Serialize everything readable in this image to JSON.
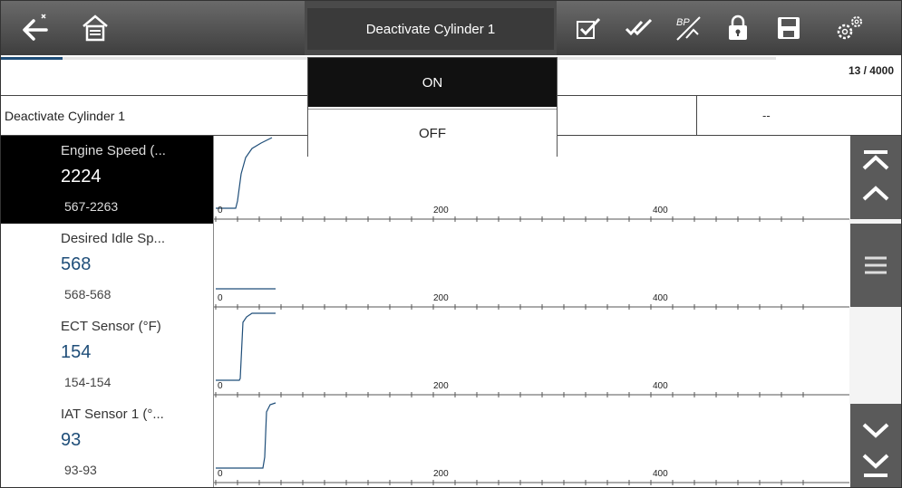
{
  "toolbar": {
    "title": "Deactivate Cylinder 1",
    "icons": [
      "back-icon",
      "home-icon",
      "checklist-icon",
      "double-check-icon",
      "pid-trigger-icon",
      "lock-icon",
      "save-icon",
      "settings-icon"
    ]
  },
  "progress": {
    "counter": "13 / 4000",
    "fraction": 0.08
  },
  "control": {
    "label": "Deactivate Cylinder 1",
    "value": "--"
  },
  "dropdown": {
    "options": [
      "ON",
      "OFF"
    ],
    "selected": "ON"
  },
  "rows": [
    {
      "name": "Engine Speed (...",
      "value": "2224",
      "range": "567-2263",
      "selected": true
    },
    {
      "name": "Desired Idle Sp...",
      "value": "568",
      "range": "568-568",
      "selected": false
    },
    {
      "name": "ECT Sensor (°F)",
      "value": "154",
      "range": "154-154",
      "selected": false
    },
    {
      "name": "IAT Sensor 1 (°...",
      "value": "93",
      "range": "93-93",
      "selected": false
    }
  ],
  "graph_axis": {
    "ticks": [
      "0",
      "200",
      "400"
    ]
  },
  "colors": {
    "toolbar": "#4a4a4a",
    "accent": "#1f4e79",
    "selected_row": "#000000",
    "scroll": "#5a5a5a"
  }
}
